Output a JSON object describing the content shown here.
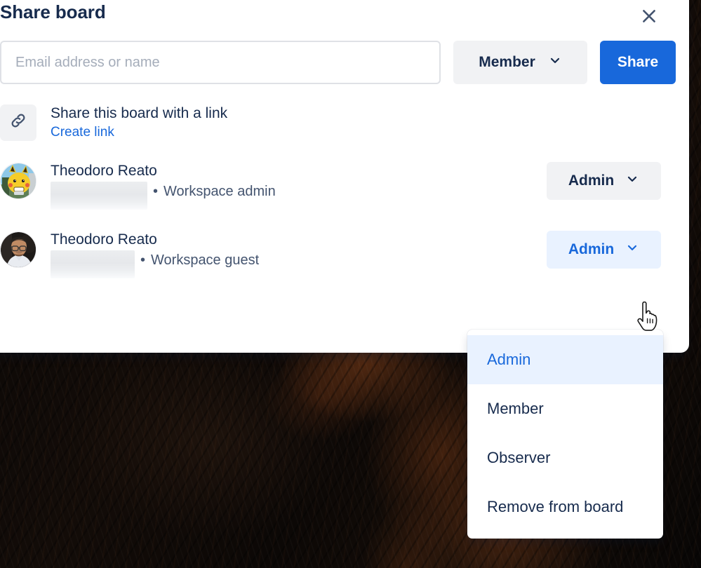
{
  "popover": {
    "title": "Share board",
    "close_icon": "close-icon"
  },
  "invite": {
    "input_placeholder": "Email address or name",
    "input_value": "",
    "role_label": "Member",
    "role_chevron_icon": "chevron-down-icon",
    "share_button_label": "Share"
  },
  "link_section": {
    "icon": "link-icon",
    "title": "Share this board with a link",
    "create_link_label": "Create link"
  },
  "members": [
    {
      "avatar": "pikachu-avatar",
      "name": "Theodoro Reato",
      "email_redacted": true,
      "separator": "•",
      "workspace_role": "Workspace admin",
      "role_label": "Admin",
      "role_chevron_icon": "chevron-down-icon",
      "role_active": false
    },
    {
      "avatar": "photo-avatar",
      "name": "Theodoro Reato",
      "email_redacted": true,
      "separator": "•",
      "workspace_role": "Workspace guest",
      "role_label": "Admin",
      "role_chevron_icon": "chevron-down-icon",
      "role_active": true
    }
  ],
  "role_dropdown": {
    "open": true,
    "selected": "Admin",
    "options": [
      {
        "label": "Admin",
        "selected": true
      },
      {
        "label": "Member",
        "selected": false
      },
      {
        "label": "Observer",
        "selected": false
      },
      {
        "label": "Remove from board",
        "selected": false
      }
    ]
  },
  "cursor": {
    "type": "pointer-hand-cursor"
  },
  "colors": {
    "accent_blue": "#1868db",
    "text_primary": "#172b4d",
    "text_subtle": "#44546f",
    "surface_neutral": "#f1f2f4",
    "selected_bg": "#e9f2ff",
    "border": "#dfe1e6",
    "background_dark": "#0b0806"
  }
}
